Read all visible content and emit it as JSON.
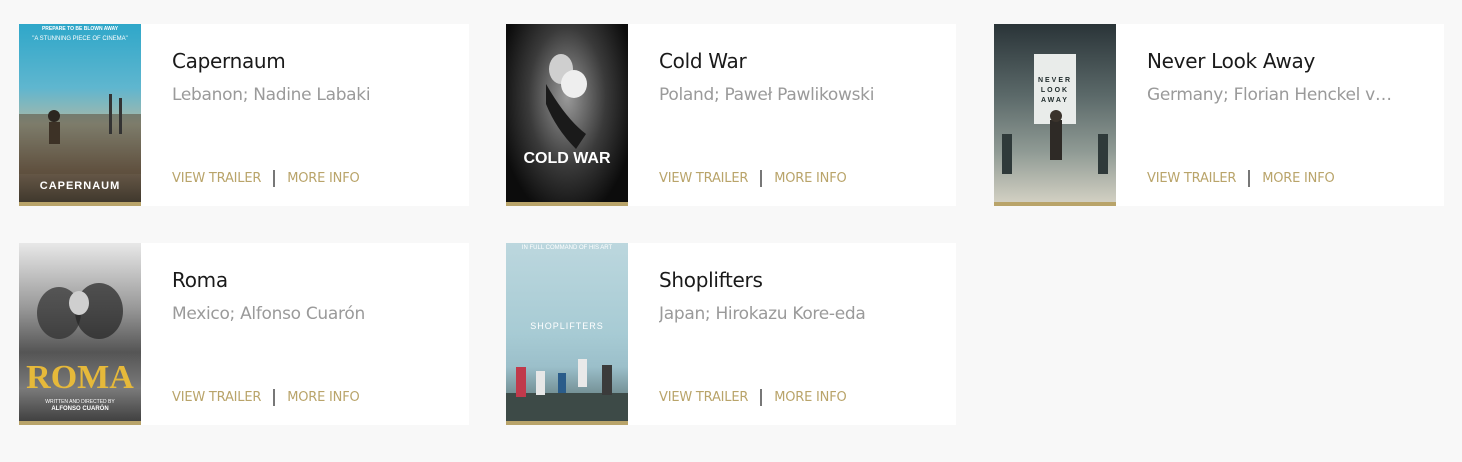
{
  "films": [
    {
      "title": "Capernaum",
      "subtitle": "Lebanon; Nadine Labaki",
      "poster_title": "CAPERNAUM",
      "poster_tagline": "\"A stunning piece of cinema\"",
      "poster_top": "Prepare to be blown away"
    },
    {
      "title": "Cold War",
      "subtitle": "Poland; Paweł Pawlikowski",
      "poster_title": "COLD WAR",
      "poster_top": ""
    },
    {
      "title": "Never Look Away",
      "subtitle": "Germany; Florian Henckel von...",
      "poster_title": "NEVER LOOK AWAY",
      "poster_top": ""
    },
    {
      "title": "Roma",
      "subtitle": "Mexico; Alfonso Cuarón",
      "poster_title": "ROMA",
      "poster_credit": "Written and directed by",
      "poster_director": "ALFONSO CUARÓN"
    },
    {
      "title": "Shoplifters",
      "subtitle": "Japan; Hirokazu Kore-eda",
      "poster_title": "SHOPLIFTERS",
      "poster_tagline": "In full command of his art"
    }
  ],
  "labels": {
    "view_trailer": "VIEW TRAILER",
    "more_info": "MORE INFO"
  },
  "colors": {
    "accent": "#b9a46a",
    "background": "#f8f8f8",
    "card": "#ffffff"
  }
}
